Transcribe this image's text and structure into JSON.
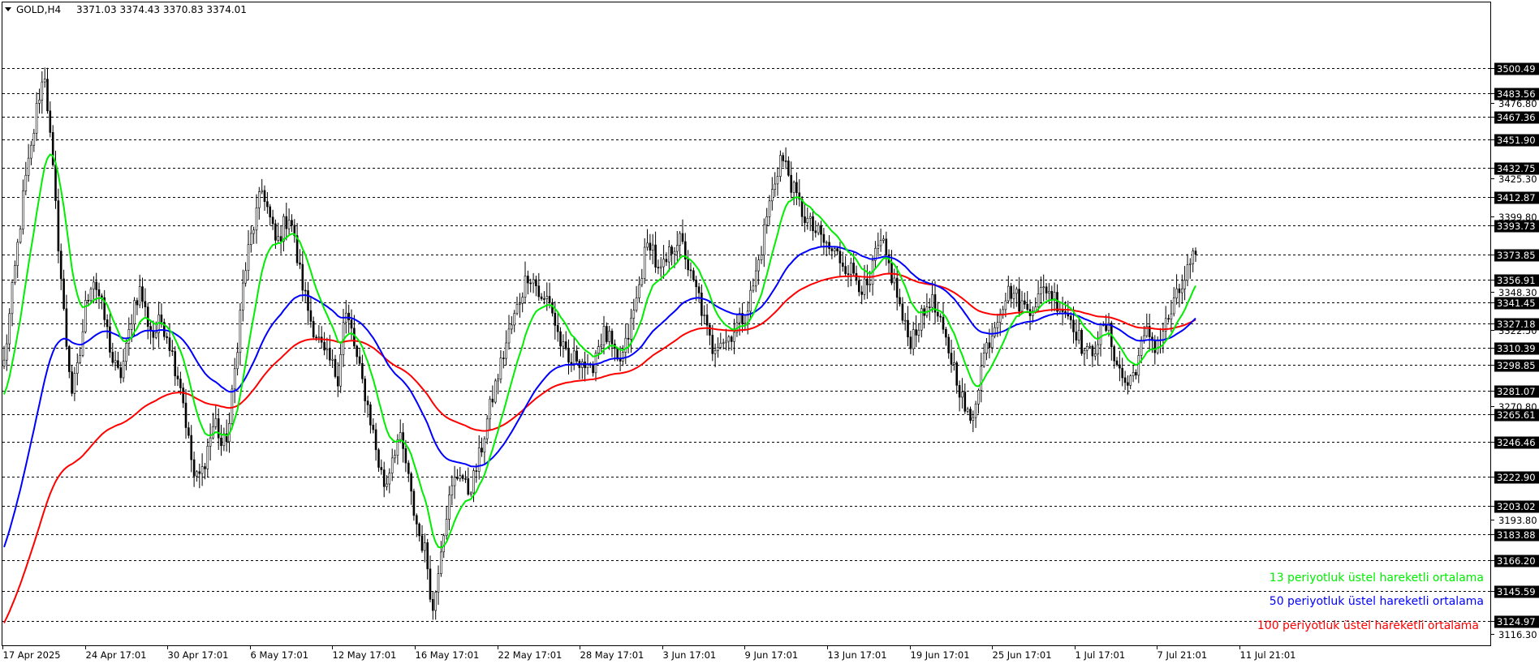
{
  "header": {
    "symbol": "GOLD,H4",
    "ohlc": "3371.03 3374.43 3370.83 3374.01"
  },
  "colors": {
    "ema13": "#00ee00",
    "ema50": "#0000ff",
    "ema100": "#ff0000",
    "candle": "#000000",
    "grid": "#000000",
    "label_bg": "#000000",
    "label_text": "#ffffff"
  },
  "legend": [
    {
      "text": "13 periyotluk üstel hareketli ortalama",
      "color": "#00ee00"
    },
    {
      "text": "50 periyotluk üstel hareketli ortalama",
      "color": "#0000ff"
    },
    {
      "text": "100 periyotluk üstel hareketli ortalama",
      "color": "#ff0000"
    }
  ],
  "chart_data": {
    "type": "line",
    "title": "GOLD,H4",
    "ylim": [
      3108.5,
      3545.0
    ],
    "grid": true,
    "legend_position": "bottom-right",
    "price_levels": [
      3500.49,
      3483.56,
      3467.36,
      3451.9,
      3432.75,
      3412.87,
      3393.73,
      3373.85,
      3356.91,
      3341.45,
      3327.18,
      3310.39,
      3298.85,
      3281.07,
      3265.61,
      3246.46,
      3222.9,
      3203.02,
      3183.88,
      3166.2,
      3145.59,
      3124.97
    ],
    "y_ticks": [
      3476.8,
      3425.3,
      3399.8,
      3348.3,
      3322.5,
      3270.8,
      3193.8,
      3116.3
    ],
    "x_ticks": [
      "17 Apr 2025",
      "24 Apr 17:01",
      "30 Apr 17:01",
      "6 May 17:01",
      "12 May 17:01",
      "16 May 17:01",
      "22 May 17:01",
      "28 May 17:01",
      "3 Jun 17:01",
      "9 Jun 17:01",
      "13 Jun 17:01",
      "19 Jun 17:01",
      "25 Jun 17:01",
      "1 Jul 17:01",
      "7 Jul 21:01",
      "11 Jul 21:01"
    ],
    "close_path": [
      3300,
      3340,
      3380,
      3420,
      3445,
      3480,
      3497,
      3440,
      3380,
      3320,
      3280,
      3300,
      3340,
      3360,
      3345,
      3325,
      3300,
      3290,
      3310,
      3340,
      3350,
      3330,
      3318,
      3330,
      3320,
      3300,
      3285,
      3250,
      3220,
      3225,
      3245,
      3262,
      3242,
      3255,
      3300,
      3350,
      3380,
      3400,
      3420,
      3398,
      3380,
      3393,
      3402,
      3372,
      3350,
      3330,
      3318,
      3305,
      3300,
      3290,
      3335,
      3322,
      3298,
      3280,
      3258,
      3232,
      3215,
      3238,
      3250,
      3232,
      3203,
      3183,
      3170,
      3130,
      3172,
      3200,
      3218,
      3228,
      3212,
      3222,
      3240,
      3262,
      3282,
      3300,
      3318,
      3332,
      3348,
      3362,
      3355,
      3340,
      3346,
      3325,
      3310,
      3298,
      3305,
      3302,
      3290,
      3310,
      3320,
      3315,
      3298,
      3306,
      3325,
      3345,
      3372,
      3385,
      3360,
      3365,
      3378,
      3385,
      3375,
      3355,
      3346,
      3325,
      3310,
      3318,
      3315,
      3322,
      3328,
      3335,
      3352,
      3373,
      3400,
      3420,
      3440,
      3432,
      3416,
      3405,
      3396,
      3390,
      3385,
      3378,
      3375,
      3370,
      3365,
      3360,
      3352,
      3348,
      3375,
      3380,
      3365,
      3350,
      3328,
      3315,
      3325,
      3332,
      3345,
      3332,
      3318,
      3305,
      3290,
      3270,
      3258,
      3285,
      3308,
      3320,
      3335,
      3345,
      3350,
      3342,
      3337,
      3340,
      3345,
      3352,
      3346,
      3340,
      3335,
      3328,
      3315,
      3305,
      3310,
      3320,
      3325,
      3308,
      3292,
      3285,
      3295,
      3310,
      3322,
      3312,
      3320,
      3330,
      3342,
      3352,
      3365,
      3374
    ]
  }
}
